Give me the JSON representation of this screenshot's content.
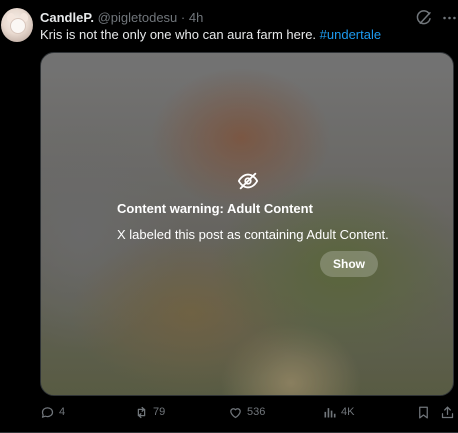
{
  "tweet": {
    "display_name": "CandleP.",
    "handle": "@pigletodesu",
    "separator": "·",
    "time": "4h",
    "text": "Kris is not the only one who can aura farm here. ",
    "hashtag": "#undertale",
    "icons": {
      "grok": "grok-slash-icon",
      "more": "more-icon"
    }
  },
  "media": {
    "warning_title": "Content warning: Adult Content",
    "warning_text": "X labeled this post as containing Adult Content.",
    "show_label": "Show",
    "icon": "eye-off-icon"
  },
  "actions": {
    "replies": "4",
    "reposts": "79",
    "likes": "536",
    "views": "4K"
  },
  "colors": {
    "background": "#000000",
    "text": "#e7e9ea",
    "muted": "#71767b",
    "link": "#1d9bf0"
  }
}
